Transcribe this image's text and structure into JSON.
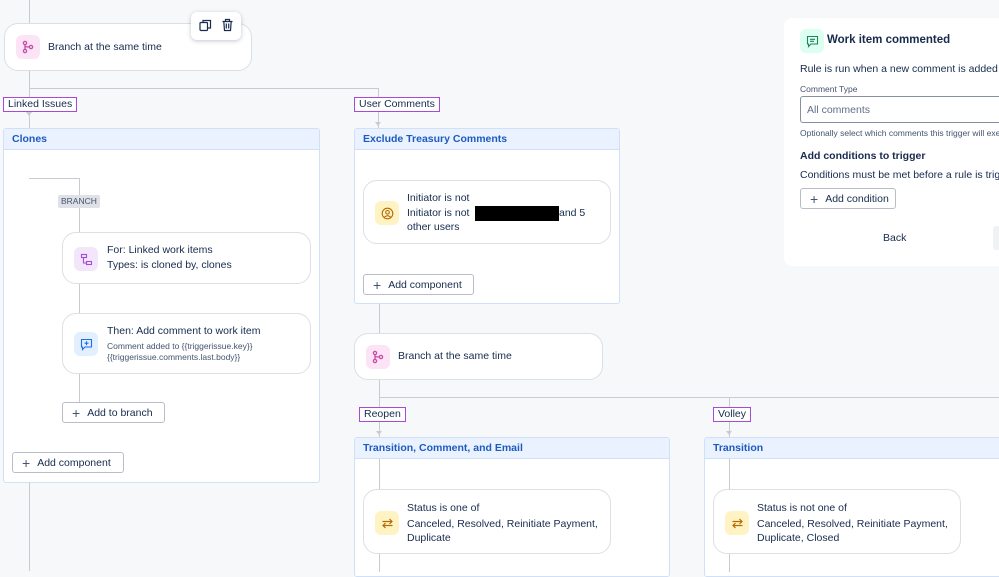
{
  "top_branch": {
    "label": "Branch at the same time"
  },
  "toolbar": {
    "duplicate_icon": "copy-icon",
    "delete_icon": "trash-icon"
  },
  "left_branch": {
    "tag": "Linked Issues",
    "group_title": "Clones",
    "branch_badge": "BRANCH",
    "for_card": {
      "line1": "For: Linked work items",
      "line2": "Types: is cloned by, clones"
    },
    "then_card": {
      "title": "Then: Add comment to work item",
      "detail1": "Comment added to {{triggerissue.key}}",
      "detail2": "{{triggerissue.comments.last.body}}"
    },
    "add_to_branch": "Add to branch",
    "add_component": "Add component"
  },
  "right_branch": {
    "tag": "User Comments",
    "group_title": "Exclude Treasury Comments",
    "initiator_card": {
      "line1": "Initiator is not",
      "line2_prefix": "Initiator is not",
      "line2_suffix": "and 5",
      "line3": "other users"
    },
    "add_component": "Add component",
    "sub_branch_label": "Branch at the same time"
  },
  "reopen_branch": {
    "tag": "Reopen",
    "group_title": "Transition, Comment, and Email",
    "status_card": {
      "line1": "Status is one of",
      "line2": "Canceled, Resolved, Reinitiate Payment,",
      "line3": "Duplicate"
    }
  },
  "volley_branch": {
    "tag": "Volley",
    "group_title": "Transition",
    "status_card": {
      "line1": "Status is not one of",
      "line2": "Canceled, Resolved, Reinitiate Payment,",
      "line3": "Duplicate, Closed"
    }
  },
  "trigger_panel": {
    "title": "Work item commented",
    "description": "Rule is run when a new comment is added t",
    "comment_type_label": "Comment Type",
    "comment_type_value": "All comments",
    "hint": "Optionally select which comments this trigger will exec",
    "conditions_heading": "Add conditions to trigger",
    "conditions_text": "Conditions must be met before a rule is trig",
    "add_condition": "Add condition",
    "back": "Back"
  },
  "colors": {
    "branch_icon_bg": "#fce4f6",
    "branch_icon_fg": "#c84ca7",
    "tag_border": "#a54bd8",
    "group_header_bg": "#e9f2fe",
    "group_title": "#1d5bbf",
    "status_icon_bg": "#fff3c4",
    "status_icon_fg": "#b46c00",
    "trigger_icon_bg": "#dcfff1"
  }
}
